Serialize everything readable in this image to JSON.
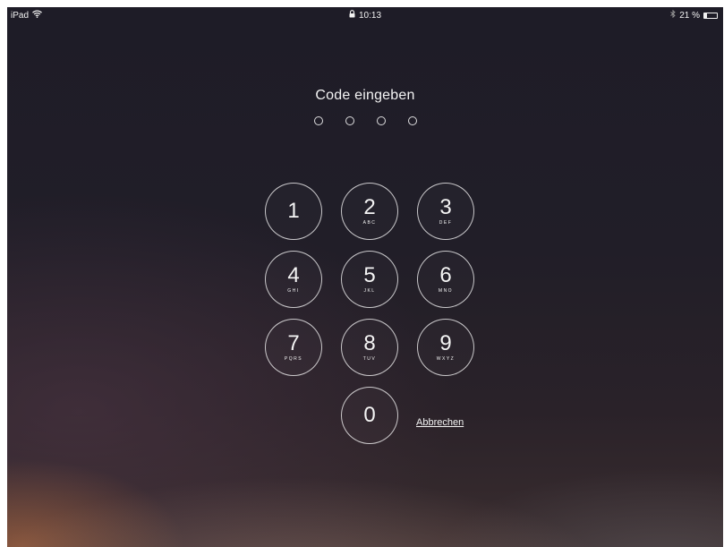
{
  "status_bar": {
    "device": "iPad",
    "wifi_icon": "wifi-icon",
    "lock_icon": "lock-icon",
    "time": "10:13",
    "bluetooth_icon": "bluetooth-icon",
    "battery_text": "21 %",
    "battery_level": 0.21
  },
  "lock_screen": {
    "prompt": "Code eingeben",
    "passcode_length": 4,
    "entered_digits": 0,
    "keys": [
      {
        "digit": "1",
        "letters": ""
      },
      {
        "digit": "2",
        "letters": "ABC"
      },
      {
        "digit": "3",
        "letters": "DEF"
      },
      {
        "digit": "4",
        "letters": "GHI"
      },
      {
        "digit": "5",
        "letters": "JKL"
      },
      {
        "digit": "6",
        "letters": "MNO"
      },
      {
        "digit": "7",
        "letters": "PQRS"
      },
      {
        "digit": "8",
        "letters": "TUV"
      },
      {
        "digit": "9",
        "letters": "WXYZ"
      },
      {
        "digit": "0",
        "letters": ""
      }
    ],
    "cancel_label": "Abbrechen"
  },
  "colors": {
    "text": "#f4f4f4",
    "background": "#211e28"
  }
}
